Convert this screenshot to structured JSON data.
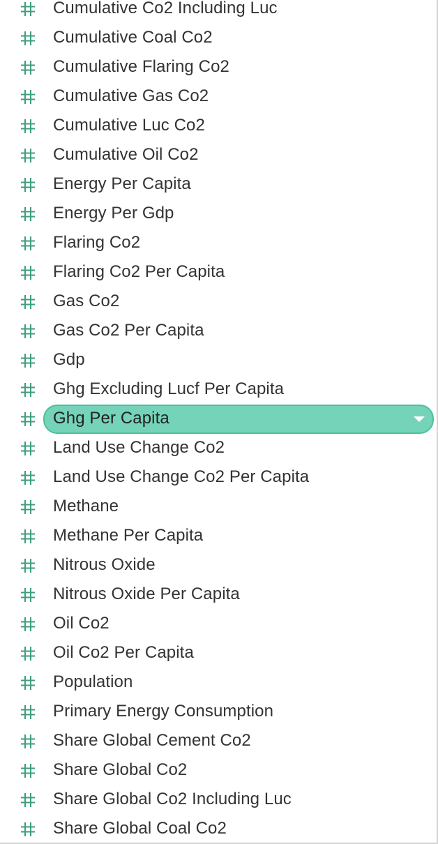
{
  "theme": {
    "hash_icon_color": "#3d9e80",
    "selected_fill": "#74d3b8",
    "selected_border": "#4fbf9b",
    "text_color": "#333333"
  },
  "fields": {
    "icon": "number-hash-icon",
    "selected_index": 14,
    "items": [
      {
        "label": "Cumulative Co2 Including Luc"
      },
      {
        "label": "Cumulative Coal Co2"
      },
      {
        "label": "Cumulative Flaring Co2"
      },
      {
        "label": "Cumulative Gas Co2"
      },
      {
        "label": "Cumulative Luc Co2"
      },
      {
        "label": "Cumulative Oil Co2"
      },
      {
        "label": "Energy Per Capita"
      },
      {
        "label": "Energy Per Gdp"
      },
      {
        "label": "Flaring Co2"
      },
      {
        "label": "Flaring Co2 Per Capita"
      },
      {
        "label": "Gas Co2"
      },
      {
        "label": "Gas Co2 Per Capita"
      },
      {
        "label": "Gdp"
      },
      {
        "label": "Ghg Excluding Lucf Per Capita"
      },
      {
        "label": "Ghg Per Capita"
      },
      {
        "label": "Land Use Change Co2"
      },
      {
        "label": "Land Use Change Co2 Per Capita"
      },
      {
        "label": "Methane"
      },
      {
        "label": "Methane Per Capita"
      },
      {
        "label": "Nitrous Oxide"
      },
      {
        "label": "Nitrous Oxide Per Capita"
      },
      {
        "label": "Oil Co2"
      },
      {
        "label": "Oil Co2 Per Capita"
      },
      {
        "label": "Population"
      },
      {
        "label": "Primary Energy Consumption"
      },
      {
        "label": "Share Global Cement Co2"
      },
      {
        "label": "Share Global Co2"
      },
      {
        "label": "Share Global Co2 Including Luc"
      },
      {
        "label": "Share Global Coal Co2"
      }
    ]
  }
}
